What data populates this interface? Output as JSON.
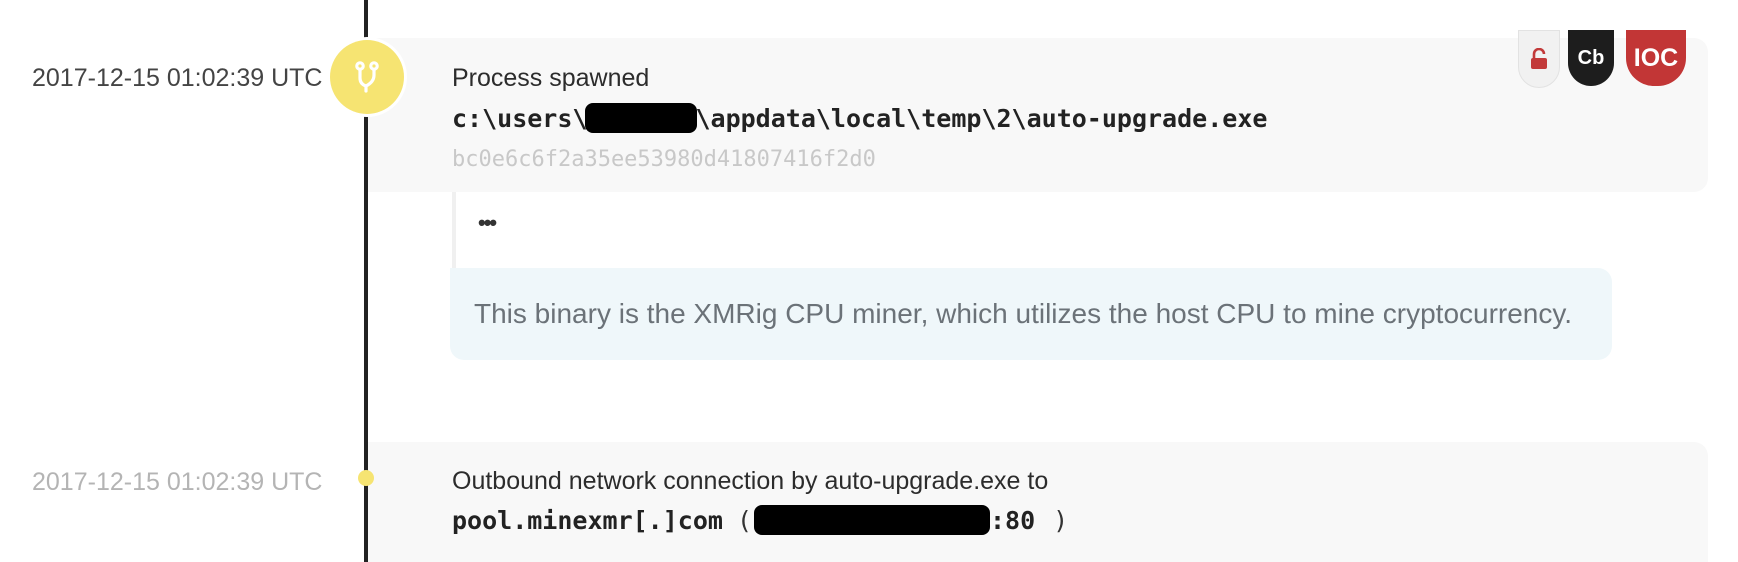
{
  "events": [
    {
      "timestamp": "2017-12-15 01:02:39 UTC",
      "title": "Process spawned",
      "path_prefix": "c:\\users\\",
      "path_suffix": "\\appdata\\local\\temp\\2\\auto-upgrade.exe",
      "hash": "bc0e6c6f2a35ee53980d41807416f2d0",
      "expand_label": "•••",
      "note": "This binary is the XMRig CPU miner, which utilizes the host CPU to mine cryptocurrency.",
      "badges": {
        "lock_icon": "lock-icon",
        "cb_label": "Cb",
        "ioc_label": "IOC"
      },
      "node_icon": "branch-icon"
    },
    {
      "timestamp": "2017-12-15 01:02:39 UTC",
      "title": "Outbound network connection by auto-upgrade.exe to",
      "host": "pool.minexmr[.]com",
      "open_paren": "(",
      "port": ":80",
      "close_paren": ")"
    }
  ],
  "colors": {
    "node_yellow": "#f6e472",
    "ioc_red": "#c23636",
    "note_bg": "#eff7fa"
  }
}
